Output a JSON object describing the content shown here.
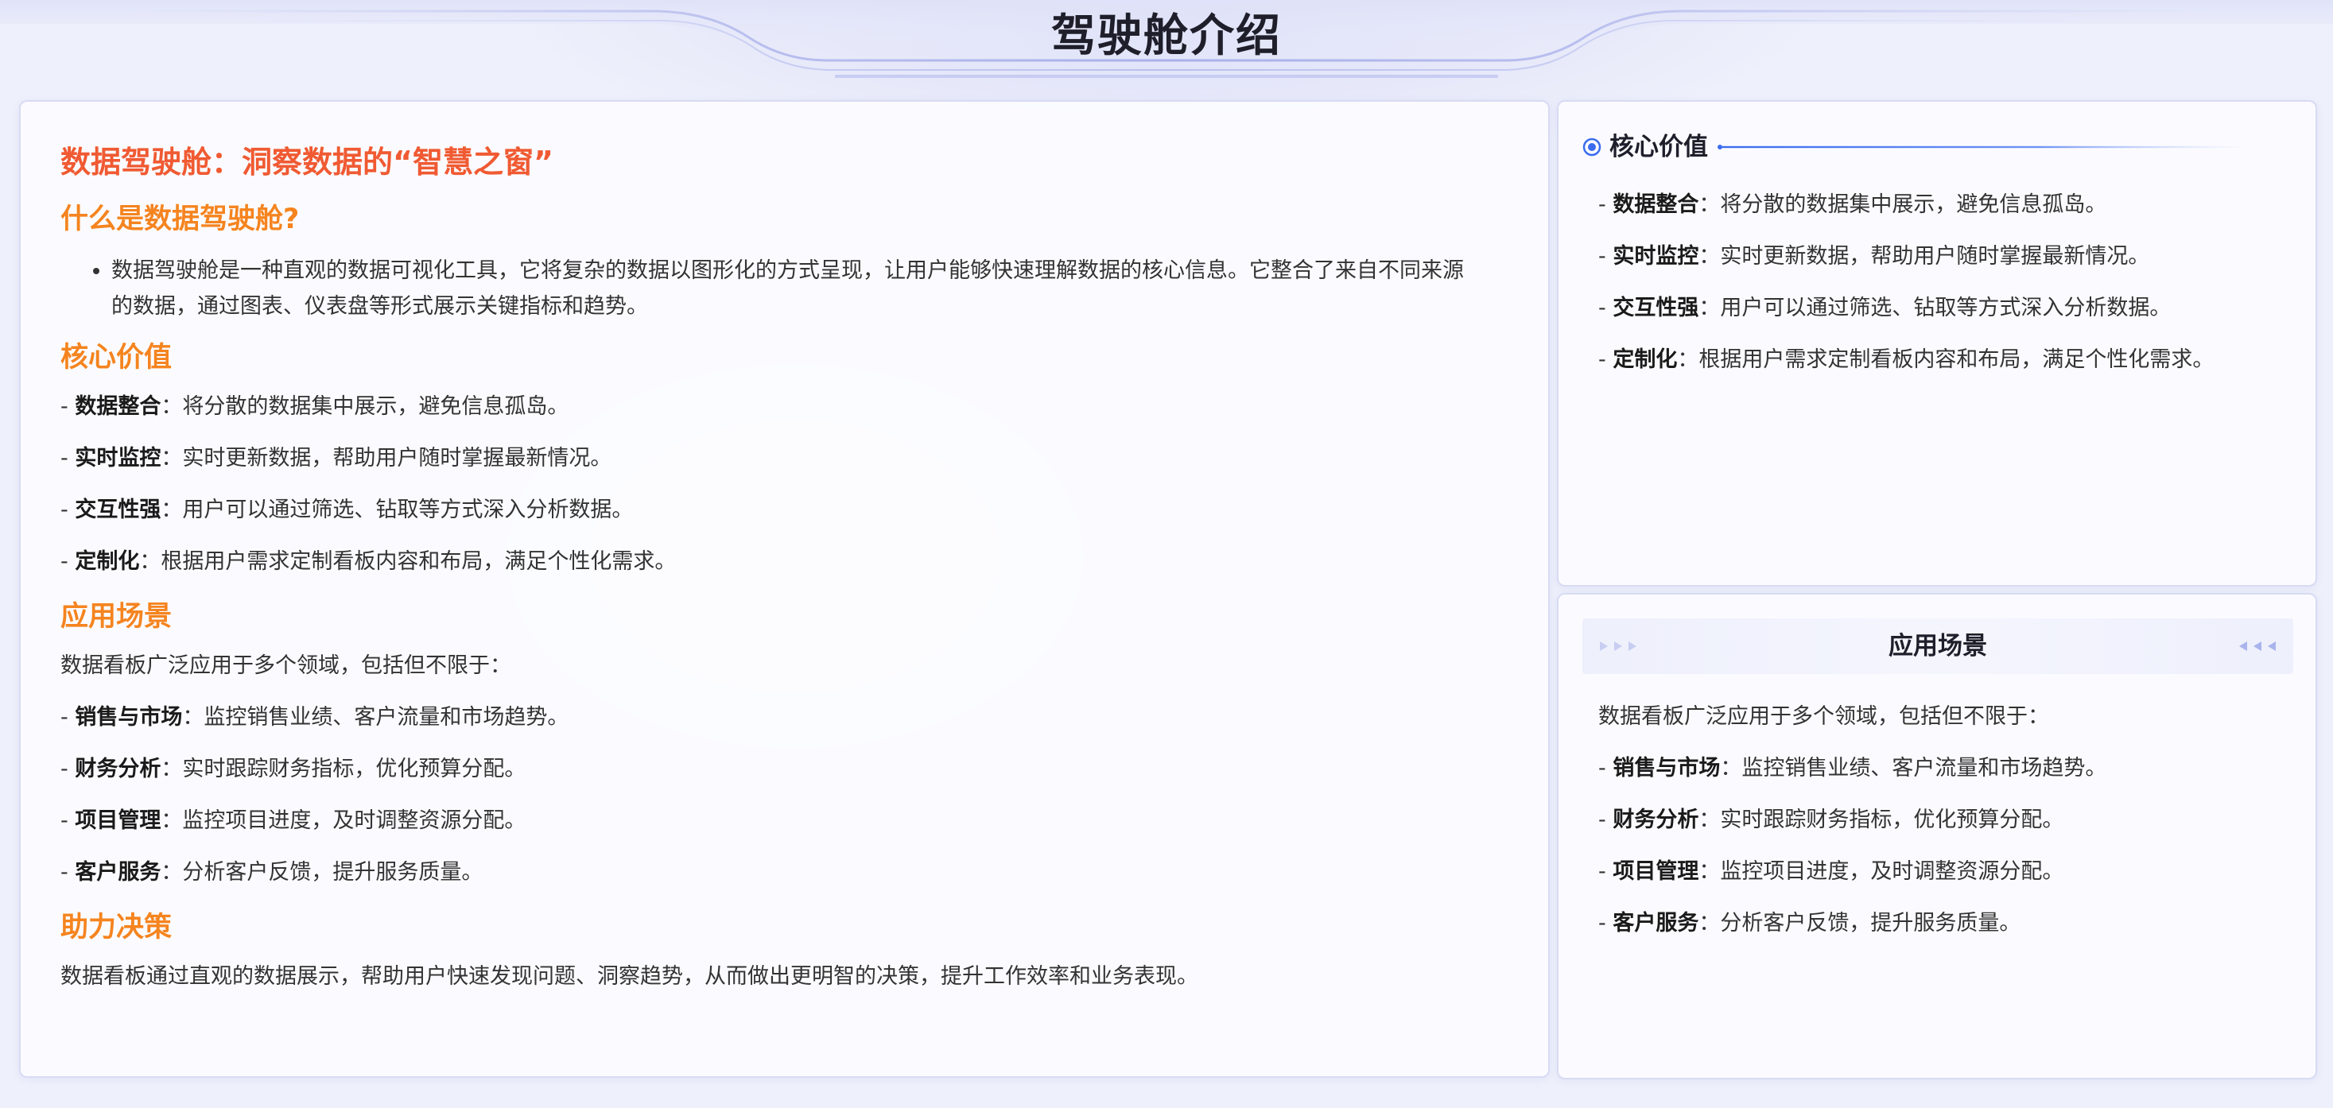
{
  "page": {
    "title": "驾驶舱介绍"
  },
  "colors": {
    "doc_title": "#f05a32",
    "section_heading": "#f5841f",
    "accent_blue": "#3b6cf0",
    "background": "#eef0fb"
  },
  "icons": {
    "section_marker": "target-icon",
    "header_arrows_left": "triple-chevron-right-icon",
    "header_arrows_right": "triple-chevron-left-icon"
  },
  "main": {
    "doc_title": "数据驾驶舱：洞察数据的“智慧之窗”",
    "what_heading": "什么是数据驾驶舱?",
    "what_bullets": [
      "数据驾驶舱是一种直观的数据可视化工具，它将复杂的数据以图形化的方式呈现，让用户能够快速理解数据的核心信息。它整合了来自不同来源的数据，通过图表、仪表盘等形式展示关键指标和趋势。"
    ],
    "value_heading": "核心价值",
    "values": [
      {
        "prefix": "- ",
        "label": "数据整合",
        "text": "：将分散的数据集中展示，避免信息孤岛。"
      },
      {
        "prefix": "- ",
        "label": "实时监控",
        "text": "：实时更新数据，帮助用户随时掌握最新情况。"
      },
      {
        "prefix": "- ",
        "label": "交互性强",
        "text": "：用户可以通过筛选、钻取等方式深入分析数据。"
      },
      {
        "prefix": "- ",
        "label": "定制化",
        "text": "：根据用户需求定制看板内容和布局，满足个性化需求。"
      }
    ],
    "scenario_heading": "应用场景",
    "scenario_intro": "数据看板广泛应用于多个领域，包括但不限于：",
    "scenarios": [
      {
        "prefix": "- ",
        "label": "销售与市场",
        "text": "：监控销售业绩、客户流量和市场趋势。"
      },
      {
        "prefix": "- ",
        "label": "财务分析",
        "text": "：实时跟踪财务指标，优化预算分配。"
      },
      {
        "prefix": "- ",
        "label": "项目管理",
        "text": "：监控项目进度，及时调整资源分配。"
      },
      {
        "prefix": "- ",
        "label": "客户服务",
        "text": "：分析客户反馈，提升服务质量。"
      }
    ],
    "decision_heading": "助力决策",
    "decision_text": "数据看板通过直观的数据展示，帮助用户快速发现问题、洞察趋势，从而做出更明智的决策，提升工作效率和业务表现。"
  },
  "side_value": {
    "title": "核心价值",
    "items": [
      {
        "prefix": "- ",
        "label": "数据整合",
        "text": "：将分散的数据集中展示，避免信息孤岛。"
      },
      {
        "prefix": "- ",
        "label": "实时监控",
        "text": "：实时更新数据，帮助用户随时掌握最新情况。"
      },
      {
        "prefix": "- ",
        "label": "交互性强",
        "text": "：用户可以通过筛选、钻取等方式深入分析数据。"
      },
      {
        "prefix": "- ",
        "label": "定制化",
        "text": "：根据用户需求定制看板内容和布局，满足个性化需求。"
      }
    ]
  },
  "side_scenario": {
    "title": "应用场景",
    "intro": "数据看板广泛应用于多个领域，包括但不限于：",
    "items": [
      {
        "prefix": "- ",
        "label": "销售与市场",
        "text": "：监控销售业绩、客户流量和市场趋势。"
      },
      {
        "prefix": "- ",
        "label": "财务分析",
        "text": "：实时跟踪财务指标，优化预算分配。"
      },
      {
        "prefix": "- ",
        "label": "项目管理",
        "text": "：监控项目进度，及时调整资源分配。"
      },
      {
        "prefix": "- ",
        "label": "客户服务",
        "text": "：分析客户反馈，提升服务质量。"
      }
    ]
  }
}
